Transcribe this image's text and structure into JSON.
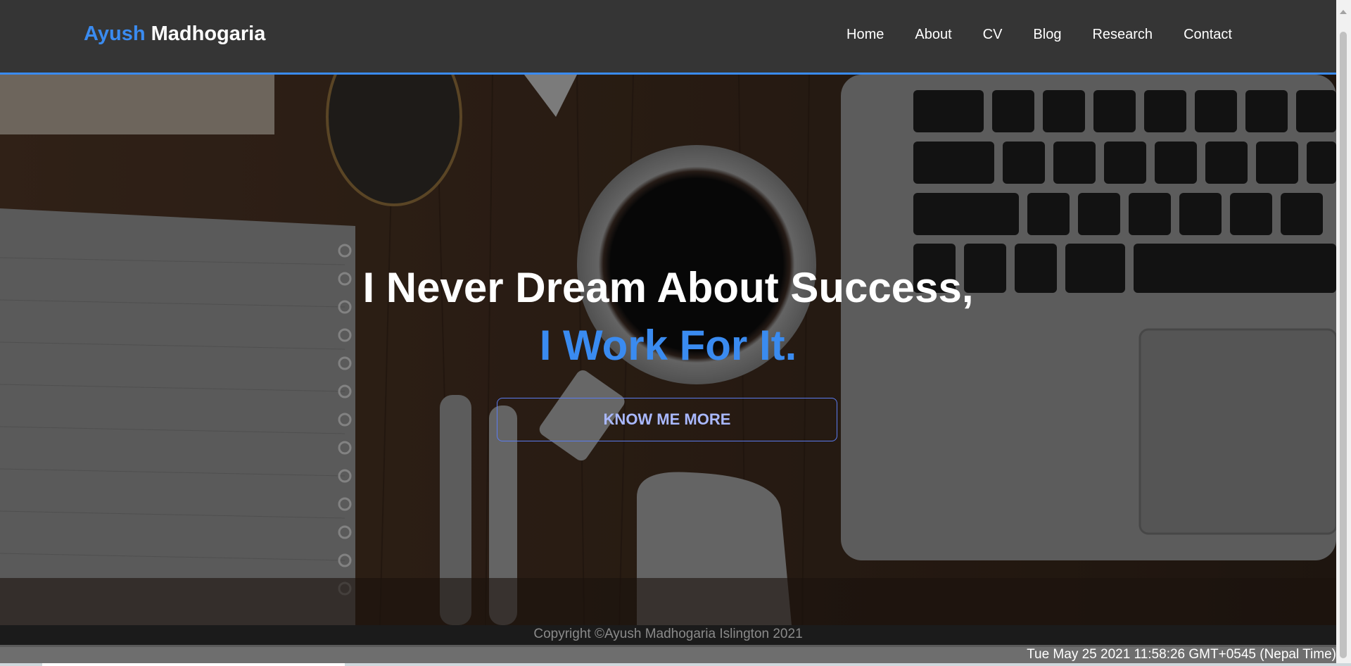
{
  "brand": {
    "first": "Ayush",
    "last": "Madhogaria"
  },
  "nav": {
    "items": [
      {
        "label": "Home"
      },
      {
        "label": "About"
      },
      {
        "label": "CV"
      },
      {
        "label": "Blog"
      },
      {
        "label": "Research"
      },
      {
        "label": "Contact"
      }
    ]
  },
  "hero": {
    "headline": "I Never Dream About Success,",
    "subheadline": "I Work For It.",
    "cta_label": "KNOW ME MORE"
  },
  "footer": {
    "copyright": "Copyright ©Ayush Madhogaria Islington 2021",
    "clock": "Tue May 25 2021 11:58:26 GMT+0545 (Nepal Time)"
  },
  "colors": {
    "accent": "#3a8bf0",
    "navbar_bg": "#353535",
    "footer_bg": "#1b1b1b"
  },
  "icons": [
    "scroll-up-arrow-icon"
  ]
}
